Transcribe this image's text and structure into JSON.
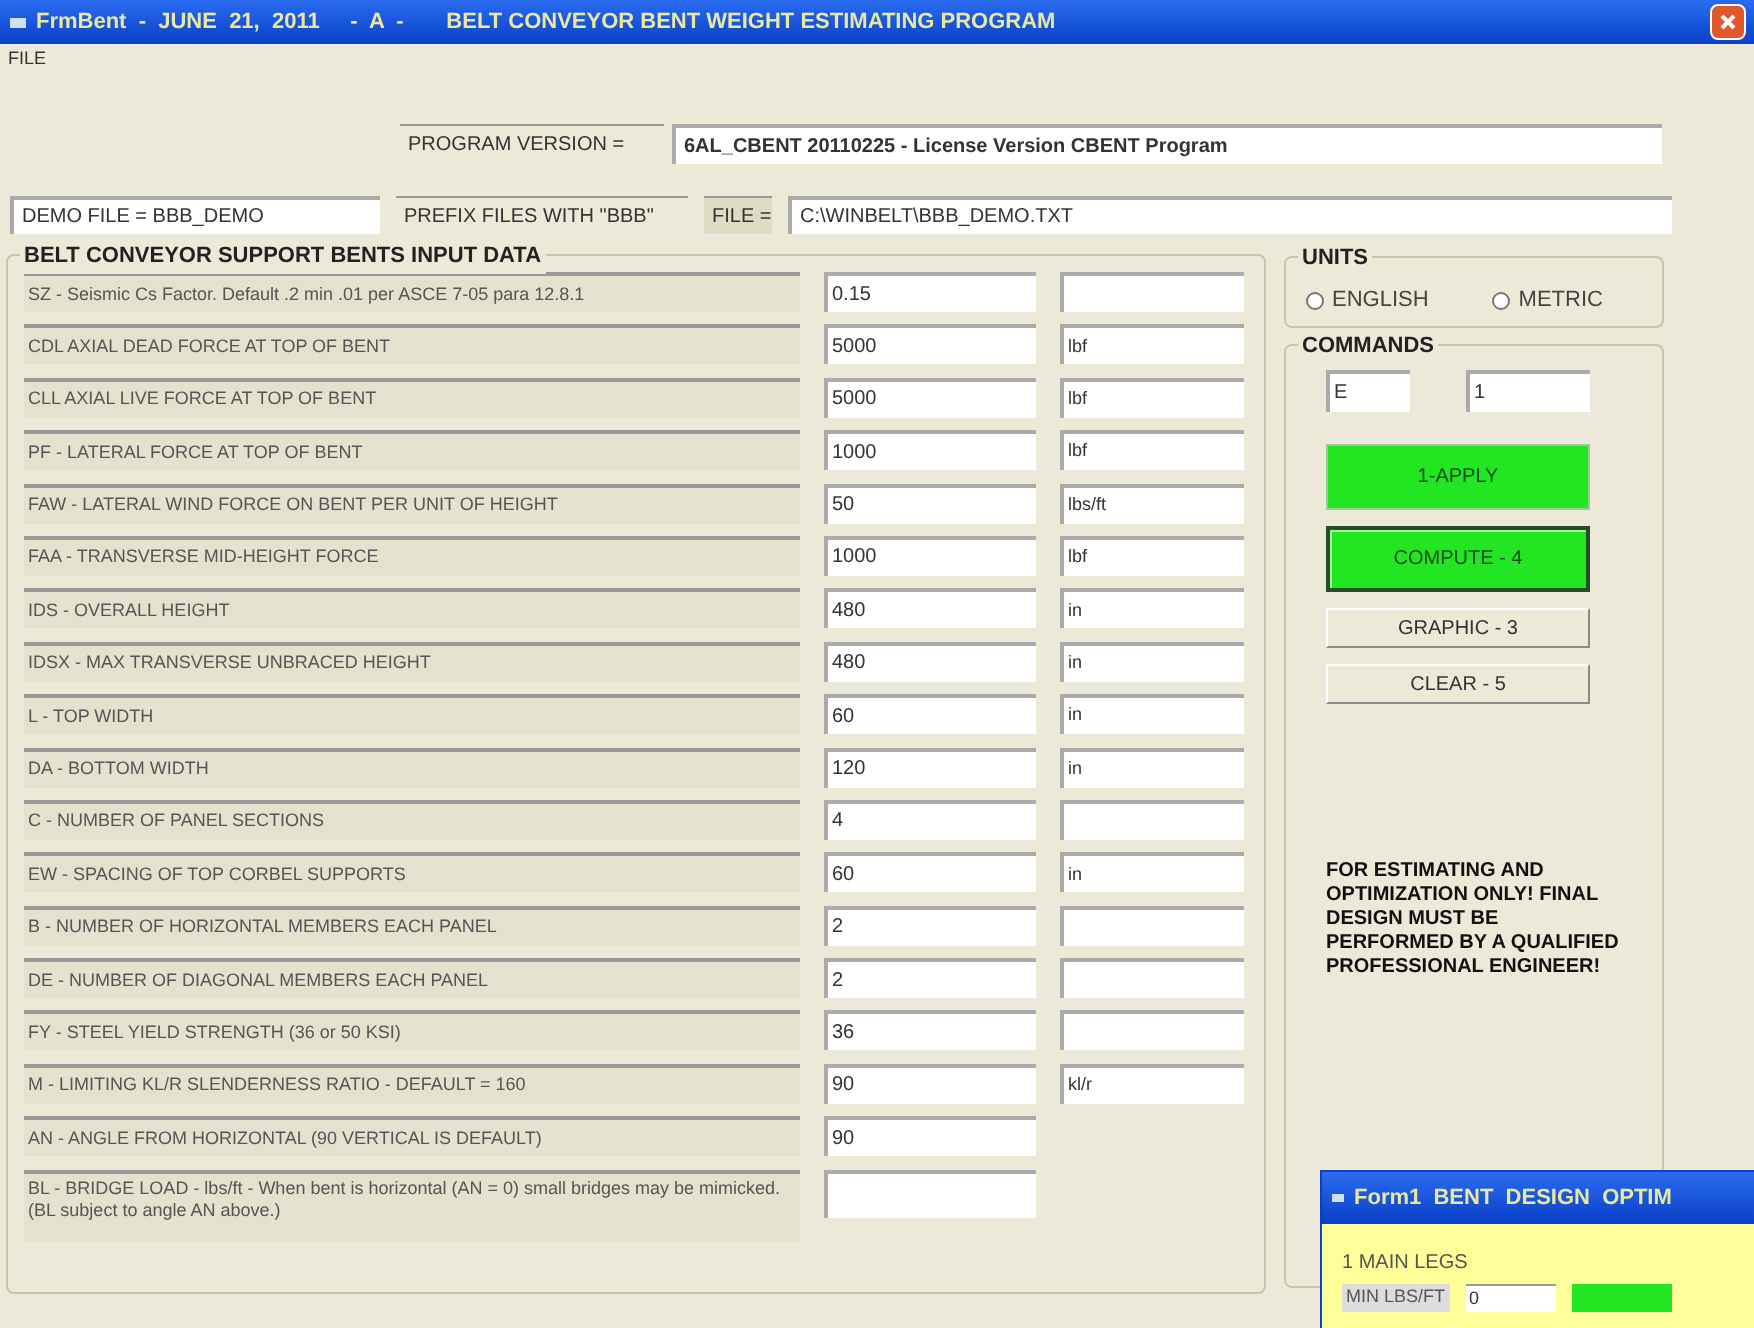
{
  "window": {
    "title": "FrmBent  -  JUNE  21,  2011     -  A  -       BELT CONVEYOR BENT WEIGHT ESTIMATING PROGRAM"
  },
  "menu": [
    "FILE"
  ],
  "program_version": {
    "label": "PROGRAM VERSION =",
    "value": "6AL_CBENT 20110225 - License Version CBENT Program"
  },
  "file_row": {
    "demo": "DEMO FILE  =  BBB_DEMO",
    "prefix": "PREFIX FILES WITH \"BBB\"",
    "file_label": "FILE =",
    "file_path": "C:\\WINBELT\\BBB_DEMO.TXT"
  },
  "input_data": {
    "title": "BELT CONVEYOR SUPPORT BENTS  INPUT DATA",
    "rows": [
      {
        "label": "SZ - Seismic Cs Factor. Default .2 min .01 per ASCE 7-05  para 12.8.1",
        "value": "0.15",
        "unit_box": true
      },
      {
        "label": "CDL  AXIAL DEAD FORCE AT TOP OF BENT",
        "value": "5000",
        "unit_box": true,
        "unit": "lbf"
      },
      {
        "label": "CLL  AXIAL LIVE FORCE AT TOP OF BENT",
        "value": "5000",
        "unit_box": true,
        "unit": "lbf"
      },
      {
        "label": "PF  - LATERAL FORCE AT TOP OF BENT",
        "value": "1000",
        "unit_box": true,
        "unit": "lbf"
      },
      {
        "label": "FAW  - LATERAL WIND FORCE ON BENT PER UNIT OF HEIGHT",
        "value": "50",
        "unit_box": true,
        "unit": "lbs/ft"
      },
      {
        "label": "FAA  - TRANSVERSE MID-HEIGHT FORCE",
        "value": "1000",
        "unit_box": true,
        "unit": "lbf"
      },
      {
        "label": "IDS  - OVERALL HEIGHT",
        "value": "480",
        "unit_box": true,
        "unit": "in"
      },
      {
        "label": "IDSX  - MAX TRANSVERSE UNBRACED HEIGHT",
        "value": "480",
        "unit_box": true,
        "unit": "in"
      },
      {
        "label": "L  - TOP WIDTH",
        "value": "60",
        "unit_box": true,
        "unit": "in"
      },
      {
        "label": "DA  -  BOTTOM WIDTH",
        "value": "120",
        "unit_box": true,
        "unit": "in"
      },
      {
        "label": "C  - NUMBER OF PANEL SECTIONS",
        "value": "4",
        "unit_box": true
      },
      {
        "label": "EW  - SPACING OF TOP CORBEL SUPPORTS",
        "value": "60",
        "unit_box": true,
        "unit": "in"
      },
      {
        "label": "B  - NUMBER OF HORIZONTAL MEMBERS EACH PANEL",
        "value": "2",
        "unit_box": true
      },
      {
        "label": "DE  - NUMBER OF DIAGONAL MEMBERS EACH PANEL",
        "value": "2",
        "unit_box": true
      },
      {
        "label": "FY  - STEEL YIELD STRENGTH  (36 or 50 KSI)",
        "value": "36",
        "unit_box": true
      },
      {
        "label": "M  - LIMITING KL/R SLENDERNESS RATIO - DEFAULT = 160",
        "value": "90",
        "unit_box": true,
        "unit": "kl/r"
      },
      {
        "label": "AN - ANGLE  FROM HORIZONTAL  (90 VERTICAL IS DEFAULT)",
        "value": "90",
        "unit_box": false
      },
      {
        "label": "BL - BRIDGE LOAD - lbs/ft -  When bent is horizontal (AN = 0) small bridges may be mimicked. (BL subject to angle AN above.)",
        "unit_box": false
      }
    ]
  },
  "units": {
    "title": "UNITS",
    "options": [
      {
        "label": "ENGLISH",
        "selected": false
      },
      {
        "label": "METRIC",
        "selected": false
      }
    ]
  },
  "commands": {
    "title": "COMMANDS",
    "field_1": "E",
    "field_2": "1",
    "buttons": [
      {
        "label": "1-APPLY",
        "kind": "green",
        "focused": false
      },
      {
        "label": "COMPUTE - 4",
        "kind": "green",
        "focused": true
      },
      {
        "label": "GRAPHIC - 3",
        "kind": "plain",
        "focused": false
      },
      {
        "label": "CLEAR - 5",
        "kind": "plain",
        "focused": false
      }
    ],
    "warning": "FOR ESTIMATING  AND OPTIMIZATION ONLY! FINAL DESIGN MUST BE PERFORMED BY A QUALIFIED PROFESSIONAL ENGINEER!"
  },
  "child_window": {
    "title": "Form1  BENT  DESIGN  OPTIM",
    "group": "1  MAIN LEGS",
    "field_label": "MIN  LBS/FT",
    "field_value": "0"
  }
}
